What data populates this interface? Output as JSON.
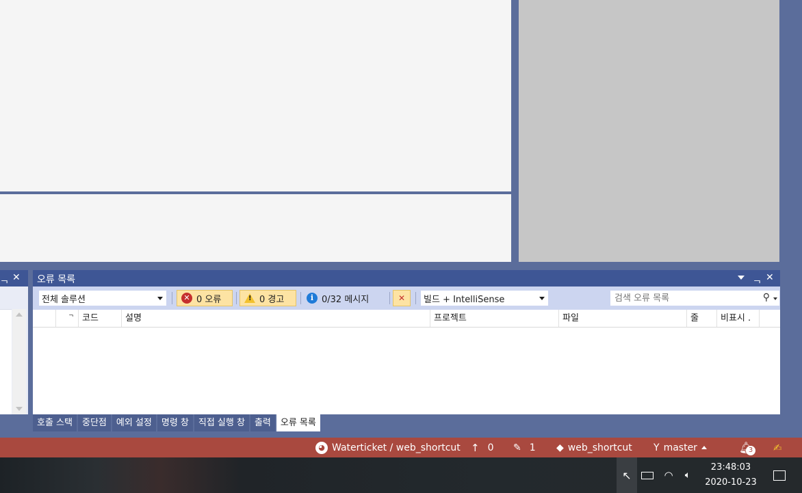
{
  "error_list": {
    "title": "오류 목록",
    "scope_dropdown": "전체 솔루션",
    "errors_toggle": "0 오류",
    "warnings_toggle": "0 경고",
    "messages_toggle": "0/32 메시지",
    "source_dropdown": "빌드 + IntelliSense",
    "search_placeholder": "검색 오류 목록",
    "columns": [
      "코드",
      "설명",
      "프로젝트",
      "파일",
      "줄",
      "비표시 ."
    ]
  },
  "bottom_tabs": [
    "호출 스택",
    "중단점",
    "예외 설정",
    "명령 창",
    "직접 실행 창",
    "출력",
    "오류 목록"
  ],
  "status_bar": {
    "repo": "Waterticket / web_shortcut",
    "push_count": "0",
    "changes_count": "1",
    "repo_name": "web_shortcut",
    "branch": "master",
    "notifications": "3"
  },
  "taskbar": {
    "time": "23:48:03",
    "date": "2020-10-23"
  },
  "colors": {
    "status_bar": "#a9493f",
    "panel_header": "#3e5695",
    "toolbar": "#ccd5f0"
  }
}
